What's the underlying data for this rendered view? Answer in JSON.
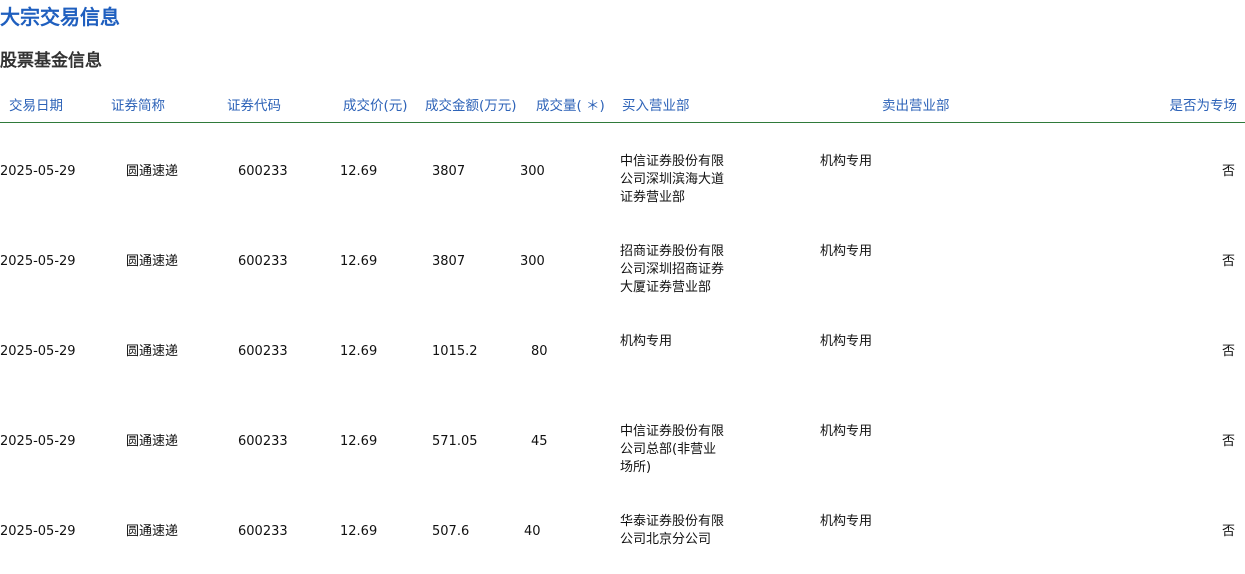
{
  "page_title": "大宗交易信息",
  "section_title": "股票基金信息",
  "table": {
    "headers": {
      "date": "交易日期",
      "name": "证券简称",
      "code": "证券代码",
      "price": "成交价(元)",
      "amount": "成交金额(万元)",
      "volume": "成交量( ＊)",
      "buyer": "买入营业部",
      "seller": "卖出营业部",
      "special": "是否为专场"
    },
    "rows": [
      {
        "date": "2025-05-29",
        "name": "圆通速递",
        "code": "600233",
        "price": "12.69",
        "amount": "3807",
        "volume": "300",
        "buyer": "中信证券股份有限公司深圳滨海大道证券营业部",
        "seller": "机构专用",
        "special": "否"
      },
      {
        "date": "2025-05-29",
        "name": "圆通速递",
        "code": "600233",
        "price": "12.69",
        "amount": "3807",
        "volume": "300",
        "buyer": "招商证券股份有限公司深圳招商证券大厦证券营业部",
        "seller": "机构专用",
        "special": "否"
      },
      {
        "date": "2025-05-29",
        "name": "圆通速递",
        "code": "600233",
        "price": "12.69",
        "amount": "1015.2",
        "volume": "80",
        "buyer": "机构专用",
        "seller": "机构专用",
        "special": "否"
      },
      {
        "date": "2025-05-29",
        "name": "圆通速递",
        "code": "600233",
        "price": "12.69",
        "amount": "571.05",
        "volume": "45",
        "buyer": "中信证券股份有限公司总部(非营业场所)",
        "seller": "机构专用",
        "special": "否"
      },
      {
        "date": "2025-05-29",
        "name": "圆通速递",
        "code": "600233",
        "price": "12.69",
        "amount": "507.6",
        "volume": "40",
        "buyer": "华泰证券股份有限公司北京分公司",
        "seller": "机构专用",
        "special": "否"
      }
    ]
  }
}
